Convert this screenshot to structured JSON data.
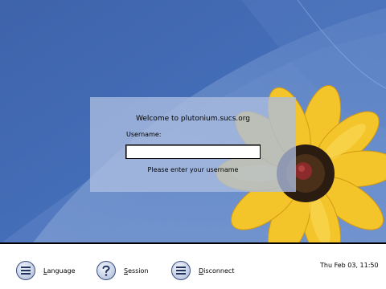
{
  "login": {
    "welcome": "Welcome to plutonium.sucs.org",
    "username_label": "Username:",
    "username_value": "",
    "hint": "Please enter your username"
  },
  "taskbar": {
    "language": {
      "label_first": "L",
      "label_rest": "anguage",
      "icon": "menu-lines-icon"
    },
    "session": {
      "label_first": "S",
      "label_rest": "ession",
      "icon": "question-mark-icon"
    },
    "disconnect": {
      "label_first": "D",
      "label_rest": "isconnect",
      "icon": "menu-lines-icon"
    }
  },
  "clock": "Thu Feb 03, 11:50",
  "colors": {
    "wallpaper_blue": "#3f67b2",
    "petal_yellow": "#f4c52a",
    "flower_center": "#3a2a1a"
  }
}
